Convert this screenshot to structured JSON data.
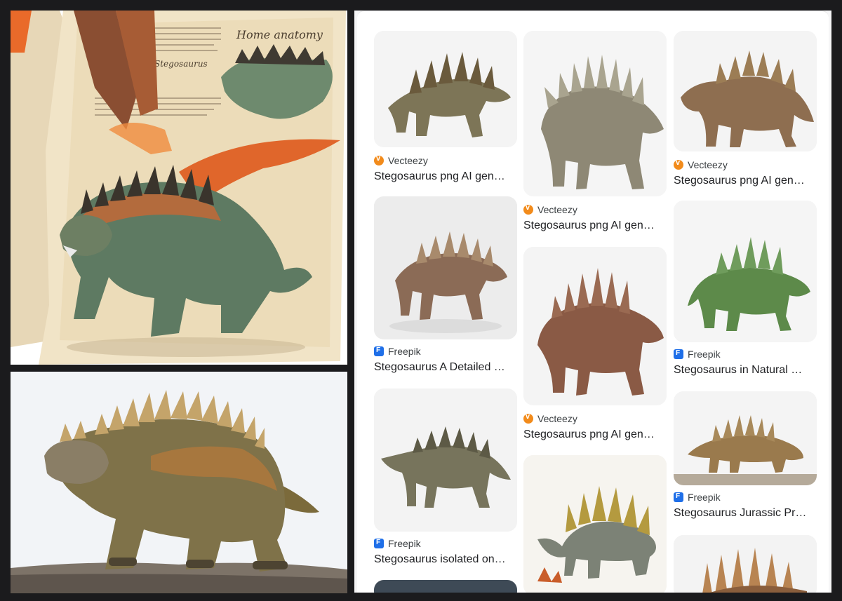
{
  "collage": {
    "top_panel": {
      "header_text": "Home anatomy",
      "note_text": "Stegosaurus"
    },
    "bottom_panel": {}
  },
  "results": {
    "column1": [
      {
        "source": "Vecteezy",
        "title": "Stegosaurus png AI gen…"
      },
      {
        "source": "Freepik",
        "title": "Stegosaurus A Detailed …"
      },
      {
        "source": "Freepik",
        "title": "Stegosaurus isolated on…"
      }
    ],
    "column2": [
      {
        "source": "Vecteezy",
        "title": "Stegosaurus png AI gen…"
      },
      {
        "source": "Vecteezy",
        "title": "Stegosaurus png AI gen…"
      }
    ],
    "column3": [
      {
        "source": "Vecteezy",
        "title": "Stegosaurus png AI gen…"
      },
      {
        "source": "Freepik",
        "title": "Stegosaurus in Natural …"
      },
      {
        "source": "Freepik",
        "title": "Stegosaurus Jurassic Pr…"
      }
    ]
  },
  "colors": {
    "background": "#1b1b1d",
    "vecteezy": "#f28b1b",
    "freepik": "#1f6fe8"
  }
}
